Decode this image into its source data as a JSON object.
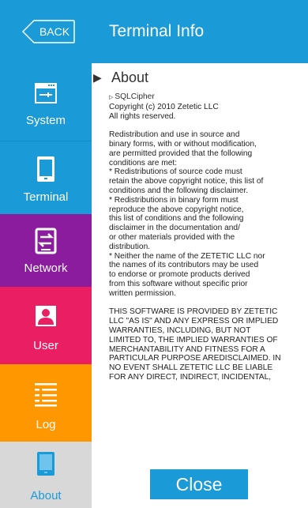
{
  "header": {
    "back_label": "BACK",
    "title": "Terminal Info"
  },
  "sidebar": {
    "items": [
      {
        "label": "System",
        "icon": "system-panel-icon",
        "color": "#1a9ad6"
      },
      {
        "label": "Terminal",
        "icon": "tablet-device-icon",
        "color": "#1a9ad6"
      },
      {
        "label": "Network",
        "icon": "network-transfer-icon",
        "color": "#8b1c9e"
      },
      {
        "label": "User",
        "icon": "user-portrait-icon",
        "color": "#e91e63"
      },
      {
        "label": "Log",
        "icon": "log-list-icon",
        "color": "#ff9800"
      },
      {
        "label": "About",
        "icon": "device-info-icon",
        "color": "#d8d8d8",
        "selected": true
      }
    ]
  },
  "content": {
    "section_title": "About",
    "library_name": "SQLCipher",
    "copyright": "Copyright (c) 2010 Zetetic LLC\nAll rights reserved.",
    "paragraph_1": "Redistribution and use in source and\nbinary forms, with or without modification,\nare permitted provided that the following\nconditions are met:\n* Redistributions of source code must\nretain the above copyright notice, this list of\nconditions and the following disclaimer.\n* Redistributions in binary form must\nreproduce the above copyright notice,\nthis list of conditions and the following\ndisclaimer in the documentation and/\nor other materials provided with the\ndistribution.\n* Neither the name of the ZETETIC LLC nor\nthe names of its contributors may be used\nto endorse or promote products derived\nfrom this software without specific prior\nwritten permission.",
    "paragraph_2": "THIS SOFTWARE IS PROVIDED BY ZETETIC\nLLC \"AS IS\" AND ANY EXPRESS OR IMPLIED\nWARRANTIES, INCLUDING, BUT NOT\nLIMITED TO, THE IMPLIED WARRANTIES OF\nMERCHANTABILITY AND FITNESS FOR A\nPARTICULAR PURPOSE AREDISCLAIMED. IN\nNO EVENT SHALL ZETETIC LLC BE LIABLE\nFOR ANY DIRECT, INDIRECT, INCIDENTAL,",
    "close_label": "Close"
  },
  "colors": {
    "header_bg": "#1a9ad6",
    "accent": "#1a9ad6",
    "selected_bg": "#d8d8d8"
  }
}
